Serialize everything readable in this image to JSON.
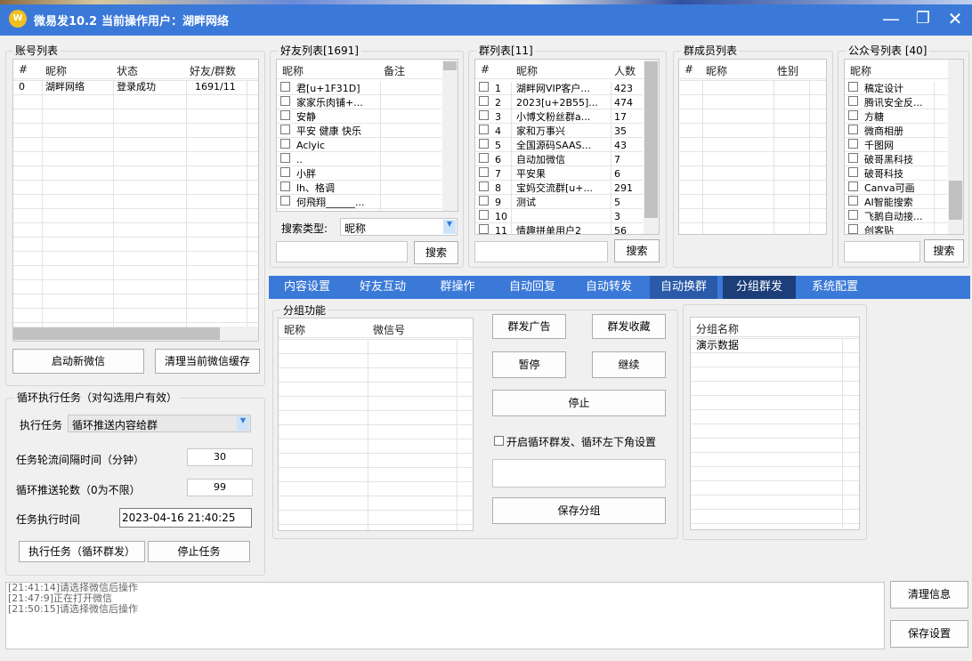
{
  "window": {
    "app_name": "微易发10.2",
    "current_user_label": "当前操作用户：湖畔网络",
    "logo_text": "W",
    "minimize_glyph": "—",
    "restore_glyph": "❐",
    "close_glyph": "✕"
  },
  "accounts": {
    "title": "账号列表",
    "columns": [
      "#",
      "昵称",
      "状态",
      "好友/群数"
    ],
    "rows": [
      {
        "idx": "0",
        "nick": "湖畔网络",
        "status": "登录成功",
        "counts": "1691/11"
      }
    ],
    "start_button": "启动新微信",
    "clear_cache_button": "清理当前微信缓存"
  },
  "friends": {
    "title": "好友列表[1691]",
    "columns": [
      "昵称",
      "备注"
    ],
    "rows": [
      "君[u+1F31D]",
      "家家乐肉铺+...",
      "安静",
      "平安 健康 快乐",
      "Aclyic",
      "..",
      "小胖",
      "lh、格调",
      "何飛翔______..."
    ],
    "search_type_label": "搜索类型:",
    "search_type_value": "昵称",
    "search_button": "搜索"
  },
  "groups": {
    "title": "群列表[11]",
    "columns": [
      "#",
      "昵称",
      "人数"
    ],
    "rows": [
      {
        "idx": "1",
        "name": "湖畔网VIP客户...",
        "count": "423"
      },
      {
        "idx": "2",
        "name": "2023[u+2B55]...",
        "count": "474"
      },
      {
        "idx": "3",
        "name": "小博文粉丝群a...",
        "count": "17"
      },
      {
        "idx": "4",
        "name": "家和万事兴",
        "count": "35"
      },
      {
        "idx": "5",
        "name": "全国源码SAAS...",
        "count": "43"
      },
      {
        "idx": "6",
        "name": "自动加微信",
        "count": "7"
      },
      {
        "idx": "7",
        "name": "平安果",
        "count": "6"
      },
      {
        "idx": "8",
        "name": "宝妈交流群[u+...",
        "count": "291"
      },
      {
        "idx": "9",
        "name": "测试",
        "count": "5"
      },
      {
        "idx": "10",
        "name": "",
        "count": "3"
      },
      {
        "idx": "11",
        "name": "情趣拼单用户2",
        "count": "56"
      }
    ],
    "search_button": "搜索"
  },
  "members": {
    "title": "群成员列表",
    "columns": [
      "#",
      "昵称",
      "性别"
    ]
  },
  "official": {
    "title": "公众号列表 [40]",
    "columns": [
      "昵称"
    ],
    "rows": [
      "稿定设计",
      "腾讯安全反...",
      "方糖",
      "微商相册",
      "千图网",
      "破哥黑科技",
      "破哥科技",
      "Canva可画",
      "AI智能搜索",
      "飞鹅自动接...",
      "创客贴"
    ],
    "search_button": "搜索"
  },
  "tabs": [
    "内容设置",
    "好友互动",
    "群操作",
    "自动回复",
    "自动转发",
    "自动换群",
    "分组群发",
    "系统配置"
  ],
  "grouping": {
    "title": "分组功能",
    "columns": [
      "昵称",
      "微信号"
    ],
    "send_ad": "群发广告",
    "send_fav": "群发收藏",
    "pause": "暂停",
    "resume": "继续",
    "stop": "停止",
    "loop_checkbox": "开启循环群发、循环左下角设置",
    "save_group": "保存分组",
    "group_name_header": "分组名称",
    "group_rows": [
      "演示数据"
    ]
  },
  "loop_task": {
    "title": "循环执行任务（对勾选用户有效）",
    "exec_label": "执行任务",
    "exec_value": "循环推送内容给群",
    "interval_label": "任务轮流间隔时间（分钟）",
    "interval_value": "30",
    "rounds_label": "循环推送轮数（0为不限）",
    "rounds_value": "99",
    "time_label": "任务执行时间",
    "time_value": "2023-04-16 21:40:25",
    "exec_button": "执行任务（循环群发）",
    "stop_button": "停止任务"
  },
  "log": {
    "lines": [
      "[21:41:14]请选择微信后操作",
      "[21:47:9]正在打开微信",
      "[21:50:15]请选择微信后操作"
    ]
  },
  "bottom": {
    "clear_info": "清理信息",
    "save_settings": "保存设置"
  },
  "colors": {
    "titlebar": "#3b79d8",
    "tab_active": "#1c3f7a"
  }
}
